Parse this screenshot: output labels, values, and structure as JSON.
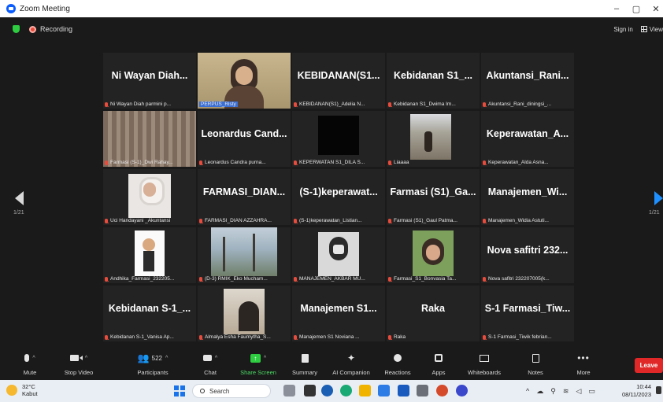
{
  "window": {
    "title": "Zoom Meeting",
    "controls": [
      "–",
      "▢",
      "✕"
    ]
  },
  "topbar": {
    "recording": "Recording",
    "signin": "Sign in",
    "view": "View"
  },
  "pages": {
    "left": "1/21",
    "right": "1/21"
  },
  "tiles": [
    {
      "big": "Ni Wayan Diah...",
      "label": "Ni Wayan Diah parmini p..."
    },
    {
      "big": "",
      "label": "PERPUS_Risty",
      "video": "person"
    },
    {
      "big": "KEBIDANAN(S1...",
      "label": "KEBIDANAN(S1)_Adelia N..."
    },
    {
      "big": "Kebidanan S1_...",
      "label": "Kebidanan S1_Dwima Im..."
    },
    {
      "big": "Akuntansi_Rani...",
      "label": "Akuntansi_Rani_diningsi_..."
    },
    {
      "big": "",
      "label": "Farmasi (S-1)_Dwi Rahay...",
      "video": "curtain"
    },
    {
      "big": "Leonardus Cand...",
      "label": "Leonardus Candra purna..."
    },
    {
      "big": "",
      "label": "KEPERWATAN S1_DILA S...",
      "video": "dark"
    },
    {
      "big": "",
      "label": "Liaaaa",
      "video": "park"
    },
    {
      "big": "Keperawatan_A...",
      "label": "Keperawatan_Alda Asna..."
    },
    {
      "big": "",
      "label": "Uci Handayani _Akuntansi",
      "video": "hijab"
    },
    {
      "big": "FARMASI_DIAN...",
      "label": "FARMASI_DIAN AZZAHRA..."
    },
    {
      "big": "(S-1)keperawat...",
      "label": "(S-1)keperawatan_Listian..."
    },
    {
      "big": "Farmasi (S1)_Ga...",
      "label": "Farmasi (S1)_Gaul Patma..."
    },
    {
      "big": "Manajemen_Wi...",
      "label": "Manajemen_Widia Astuti..."
    },
    {
      "big": "",
      "label": "Andhika_Farmasi_232205...",
      "video": "figure"
    },
    {
      "big": "",
      "label": "(D-3) RMIK_Eko Mucham...",
      "video": "trees"
    },
    {
      "big": "",
      "label": "MANAJEMEN_AKBAR MU...",
      "video": "bw"
    },
    {
      "big": "",
      "label": "Farmasi_S1_Bonvasia Ta...",
      "video": "portrait"
    },
    {
      "big": "Nova safitri 232...",
      "label": "Nova safitri 232207005(k..."
    },
    {
      "big": "Kebidanan S-1_...",
      "label": "Kebidanan S-1_Vanisa Ap..."
    },
    {
      "big": "",
      "label": "Almalya Esha Faumytha_S...",
      "video": "soft"
    },
    {
      "big": "Manajemen S1...",
      "label": "Manajemen S1 Noviana ..."
    },
    {
      "big": "Raka",
      "label": "Raka"
    },
    {
      "big": "S-1 Farmasi_Tiw...",
      "label": "S-1 Farmasi_Tiwik febrian..."
    }
  ],
  "toolbar": {
    "mute": "Mute",
    "stop_video": "Stop Video",
    "participants": "Participants",
    "participants_count": "522",
    "chat": "Chat",
    "share_screen": "Share Screen",
    "summary": "Summary",
    "ai_companion": "AI Companion",
    "reactions": "Reactions",
    "apps": "Apps",
    "whiteboards": "Whiteboards",
    "notes": "Notes",
    "more": "More",
    "leave": "Leave"
  },
  "taskbar": {
    "temp": "32°C",
    "weather": "Kabut",
    "search": "Search",
    "time": "10:44",
    "date": "08/11/2023"
  },
  "colors": {
    "accent_green": "#4cd964",
    "leave_red": "#e02828",
    "active_border": "#7fd14d"
  }
}
